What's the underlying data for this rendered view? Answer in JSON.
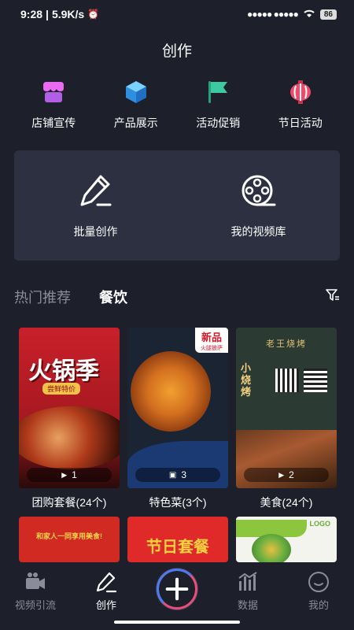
{
  "status": {
    "time": "9:28",
    "speed": "5.9K/s",
    "battery": "86",
    "signal": "●●●●● ●●●●●"
  },
  "page_title": "创作",
  "quick_actions": [
    {
      "label": "店铺宣传",
      "icon": "shop-icon",
      "color": "#ea6bf2"
    },
    {
      "label": "产品展示",
      "icon": "cube-icon",
      "color": "#3aa5f0"
    },
    {
      "label": "活动促销",
      "icon": "flag-icon",
      "color": "#3ec9a0"
    },
    {
      "label": "节日活动",
      "icon": "lantern-icon",
      "color": "#f04a6a"
    }
  ],
  "panel": {
    "batch_label": "批量创作",
    "library_label": "我的视频库"
  },
  "tabs": {
    "hot": "热门推荐",
    "food": "餐饮"
  },
  "cards": [
    {
      "label": "团购套餐(24个)",
      "count": "1",
      "count_icon": "play-icon"
    },
    {
      "label": "特色菜(3个)",
      "count": "3",
      "count_icon": "image-icon"
    },
    {
      "label": "美食(24个)",
      "count": "2",
      "count_icon": "play-icon"
    }
  ],
  "card_thumbs": {
    "hotpot_title": "火锅季",
    "hotpot_sub": "尝鲜特价",
    "new_badge": "新品",
    "new_sub": "火腿披萨",
    "bbq_title": "小烧烤",
    "bbq_head": "老王烧烤",
    "festival_title": "节日套餐",
    "family_title": "和家人一同享用美食!",
    "logo_text": "LOGO"
  },
  "nav": [
    {
      "label": "视频引流",
      "icon": "video-camera-icon"
    },
    {
      "label": "创作",
      "icon": "pencil-icon"
    },
    {
      "label": "数据",
      "icon": "chart-icon"
    },
    {
      "label": "我的",
      "icon": "profile-icon"
    }
  ],
  "colors": {
    "background": "#1d1f2b",
    "panel": "#2d3040",
    "accent_pink": "#e94d7a",
    "accent_blue": "#4a7cf0"
  }
}
